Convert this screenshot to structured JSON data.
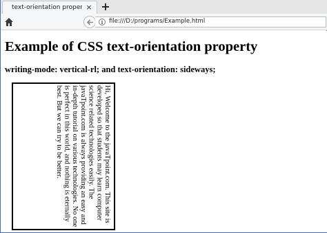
{
  "browser": {
    "tab": {
      "title": "text-orientation property",
      "close_glyph": "×"
    },
    "new_tab_glyph": "+",
    "url": "file:///D:/programs/Example.html",
    "icons": {
      "home": "home-icon",
      "back": "back-arrow-icon",
      "info": "info-icon"
    }
  },
  "page": {
    "heading": "Example of CSS text-orientation property",
    "subheading": "writing-mode: vertical-rl; and text-orientation: sideways;",
    "demo_text": "Hi, Welcome to the javaTpoint.com. This site is developed so that students may learn computer science related technologies easily. The javaTpoint.com is always providing an easy and in-depth tutorial on various technologies. No one is perfect in this world, and nothing is eternally best. But we can try to be better."
  },
  "colors": {
    "window_border": "#3d6fb0",
    "toolbar_bg": "#f5f6f7",
    "tabstrip_bg": "#e6e6e6"
  }
}
